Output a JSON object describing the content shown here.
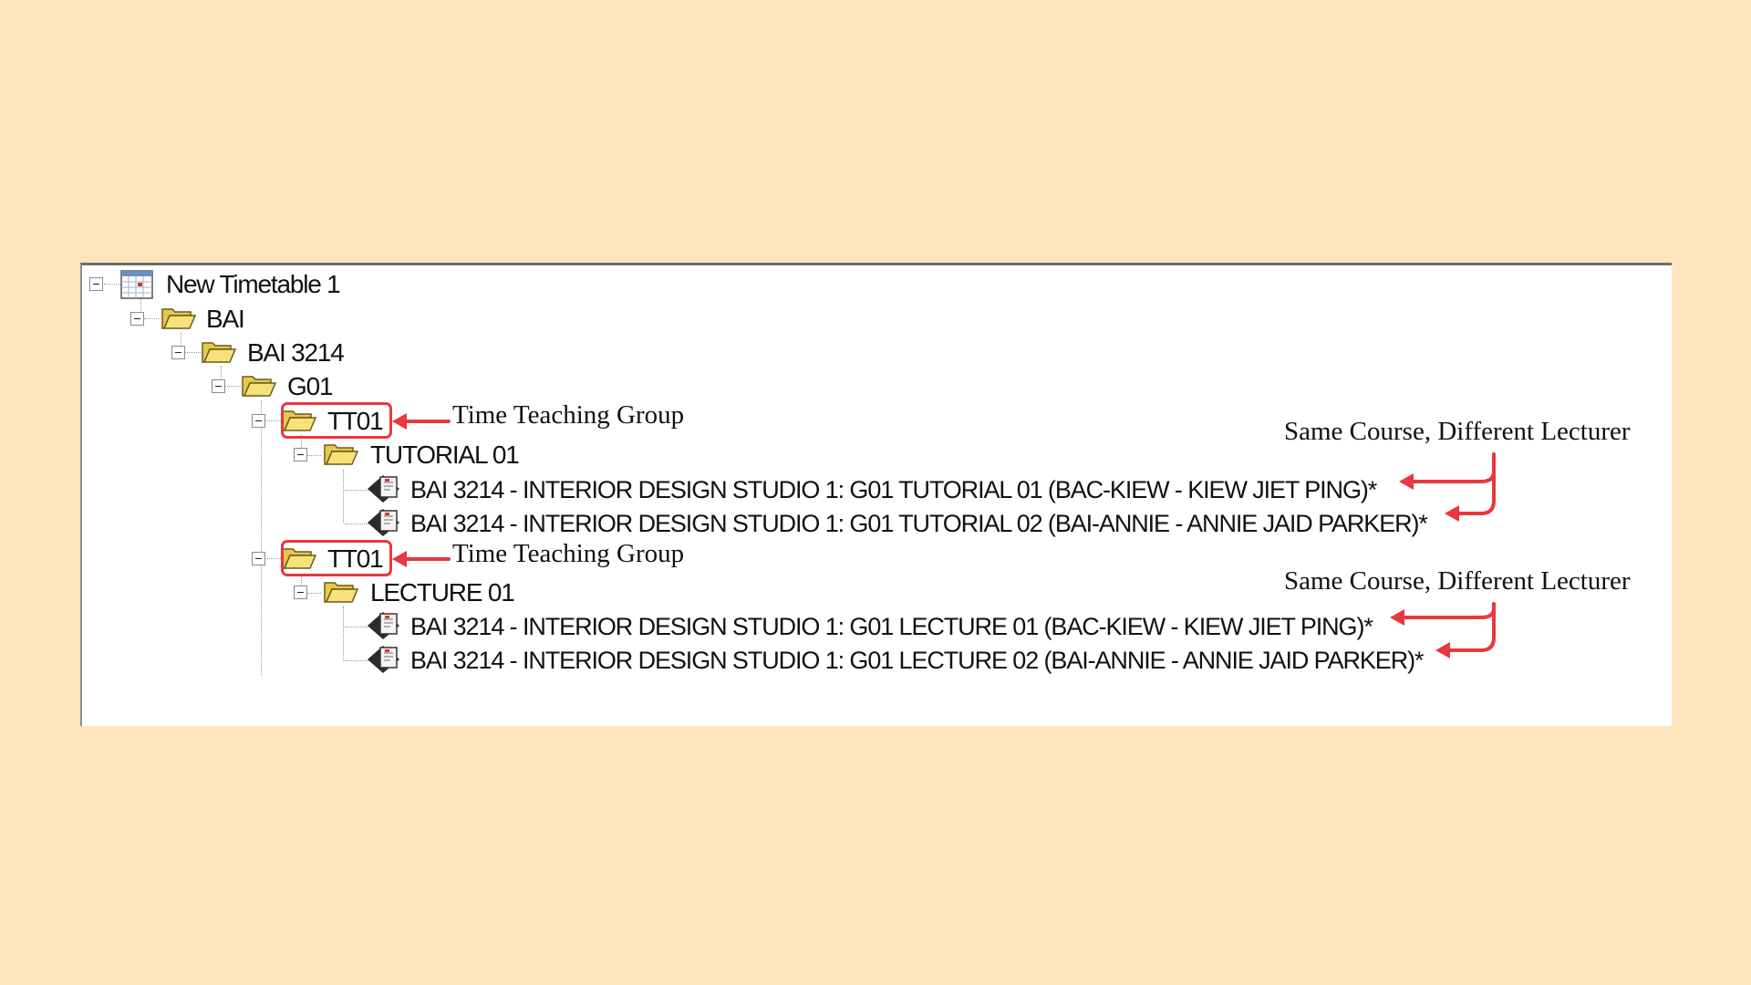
{
  "tree": {
    "root": {
      "label": "New Timetable 1",
      "icon": "calendar-icon"
    },
    "faculty": {
      "label": "BAI",
      "icon": "folder-icon"
    },
    "course": {
      "label": "BAI 3214",
      "icon": "folder-icon"
    },
    "group": {
      "label": "G01",
      "icon": "folder-icon"
    },
    "teaching_groups": [
      {
        "label": "TT01",
        "activity": {
          "label": "TUTORIAL 01"
        },
        "items": [
          {
            "label": "BAI 3214 - INTERIOR DESIGN STUDIO 1: G01 TUTORIAL 01 (BAC-KIEW - KIEW JIET PING)*"
          },
          {
            "label": "BAI 3214 - INTERIOR DESIGN STUDIO 1: G01 TUTORIAL  02 (BAI-ANNIE - ANNIE JAID PARKER)*"
          }
        ]
      },
      {
        "label": "TT01",
        "activity": {
          "label": "LECTURE 01"
        },
        "items": [
          {
            "label": "BAI 3214 - INTERIOR DESIGN STUDIO 1: G01 LECTURE 01 (BAC-KIEW - KIEW JIET PING)*"
          },
          {
            "label": "BAI 3214 - INTERIOR DESIGN STUDIO 1: G01 LECTURE  02 (BAI-ANNIE - ANNIE JAID PARKER)*"
          }
        ]
      }
    ]
  },
  "annotations": {
    "teaching_group_1": "Time Teaching Group",
    "teaching_group_2": "Time Teaching Group",
    "lecturer_note_1": "Same Course, Different Lecturer",
    "lecturer_note_2": "Same Course, Different Lecturer"
  },
  "colors": {
    "background": "#fee5bb",
    "annotation_red": "#e8373d",
    "folder_yellow": "#f5e27a"
  }
}
